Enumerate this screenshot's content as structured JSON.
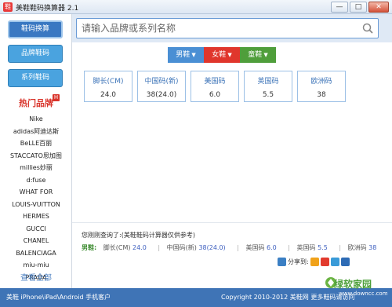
{
  "window": {
    "title": "美鞋鞋码换算器 2.1",
    "controls": [
      "—",
      "□",
      "✕"
    ]
  },
  "sidebar": {
    "buttons": [
      "鞋码换算",
      "品牌鞋码",
      "系列鞋码"
    ],
    "hot_title": "热门品牌",
    "hot_badge": "H",
    "brands": [
      "Nike",
      "adidas阿迪达斯",
      "BeLLE百丽",
      "STACCATO思加图",
      "millies妙丽",
      "d:fuse",
      "WHAT FOR",
      "LOUIS-VUITTON",
      "HERMES",
      "GUCCI",
      "CHANEL",
      "BALENCIAGA",
      "miu-miu",
      "PRADA"
    ],
    "view_all": "查看全部"
  },
  "search": {
    "placeholder": "请输入品牌或系列名称"
  },
  "tabs": [
    {
      "label": "男鞋",
      "color": "#4a8fd4"
    },
    {
      "label": "女鞋",
      "color": "#e0362c"
    },
    {
      "label": "童鞋",
      "color": "#4f9e3b"
    }
  ],
  "cards": [
    {
      "label": "脚长(CM)",
      "value": "24.0"
    },
    {
      "label": "中国码(新)",
      "value": "38(24.0)"
    },
    {
      "label": "美国码",
      "value": "6.0"
    },
    {
      "label": "英国码",
      "value": "5.5"
    },
    {
      "label": "欧洲码",
      "value": "38"
    }
  ],
  "recent": {
    "title": "您刚刚查询了:(美鞋鞋码计算器仅供参考)",
    "gender": "男鞋:",
    "items": [
      {
        "label": "脚长(CM)",
        "value": "24.0"
      },
      {
        "label": "中国码(新)",
        "value": "38(24.0)"
      },
      {
        "label": "美国码",
        "value": "6.0"
      },
      {
        "label": "英国码",
        "value": "5.5"
      },
      {
        "label": "欧洲码",
        "value": "38"
      }
    ],
    "separator": "|"
  },
  "share": {
    "label": "分享到:"
  },
  "footer": {
    "left": "美鞋 iPhone\\iPad\\Android 手机客户",
    "right": "Copyright 2010-2012 美鞋网 更多鞋码请访问"
  },
  "watermark": {
    "text": "绿软家园",
    "url": "www.downcc.com"
  },
  "colors": {
    "accent": "#3f74b6",
    "hot": "#d9342b"
  }
}
